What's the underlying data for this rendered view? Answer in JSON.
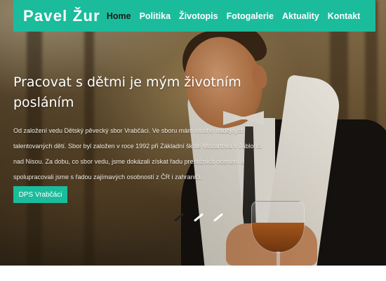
{
  "brand": {
    "name": "Pavel Žur"
  },
  "nav": {
    "items": [
      {
        "label": "Home",
        "active": true
      },
      {
        "label": "Politika",
        "active": false
      },
      {
        "label": "Životopis",
        "active": false
      },
      {
        "label": "Fotogalerie",
        "active": false
      },
      {
        "label": "Aktuality",
        "active": false
      },
      {
        "label": "Kontakt",
        "active": false
      }
    ]
  },
  "slide": {
    "headline": "Pracovat s dětmi je mým životním posláním",
    "description": "Od založení vedu Dětský pěvecký sbor Vrabčáci. Ve sboru mám mnoho nadějných talentovaných dětí. Sbor byl založen v roce 1992 při Základní škole Mozartova v Jablonci nad Nisou. Za dobu, co sbor vedu, jsme dokázali získat řadu prestižních ocenění a spolupracovali jsme s řadou zajímavých osobností z ČR i zahraničí.",
    "button_label": "DPS Vrabčáci"
  },
  "slider": {
    "count": 3,
    "active_index": 0
  },
  "colors": {
    "accent": "#1abc9c",
    "active_nav": "#1b1b1b",
    "text_light": "#ffffff"
  }
}
